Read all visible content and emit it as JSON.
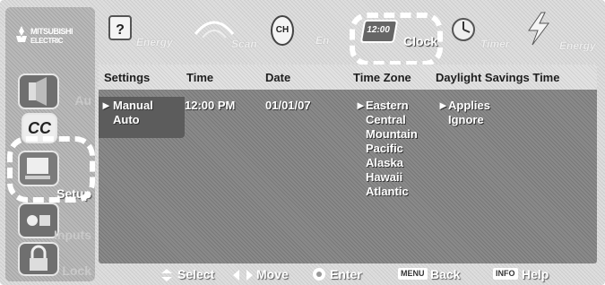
{
  "brand": {
    "line1": "MITSUBISHI",
    "line2": "ELECTRIC"
  },
  "sidebar": {
    "items": [
      {
        "label": "Au",
        "icon": "audio-icon"
      },
      {
        "label": "",
        "icon": "cc-icon",
        "glyph": "CC"
      },
      {
        "label": "Setup",
        "icon": "setup-icon"
      },
      {
        "label": "Inputs",
        "icon": "inputs-icon"
      },
      {
        "label": "Lock",
        "icon": "lock-icon"
      }
    ]
  },
  "top_menu": {
    "items": [
      {
        "label": "Energy",
        "icon": "energy-star-icon"
      },
      {
        "label": "Scan",
        "icon": "scan-icon"
      },
      {
        "label": "En",
        "icon": "channel-icon"
      },
      {
        "label": "Clock",
        "icon": "clock-icon",
        "glyph": "12:00",
        "active": true
      },
      {
        "label": "Timer",
        "icon": "timer-icon"
      },
      {
        "label": "Energy",
        "icon": "energy-icon"
      }
    ]
  },
  "table": {
    "headers": [
      "Settings",
      "Time",
      "Date",
      "Time Zone",
      "Daylight Savings Time"
    ],
    "settings_options": [
      {
        "label": "Manual",
        "selected": true
      },
      {
        "label": "Auto",
        "selected": false
      }
    ],
    "time": "12:00 PM",
    "date": "01/01/07",
    "time_zones": [
      "Eastern",
      "Central",
      "Mountain",
      "Pacific",
      "Alaska",
      "Hawaii",
      "Atlantic"
    ],
    "time_zone_selected": "Eastern",
    "dst_options": [
      "Applies",
      "Ignore"
    ],
    "dst_selected": "Applies",
    "pointer": "►"
  },
  "bottom_bar": {
    "select": "Select",
    "move": "Move",
    "enter": "Enter",
    "back_key": "MENU",
    "back": "Back",
    "help_key": "INFO",
    "help": "Help"
  }
}
